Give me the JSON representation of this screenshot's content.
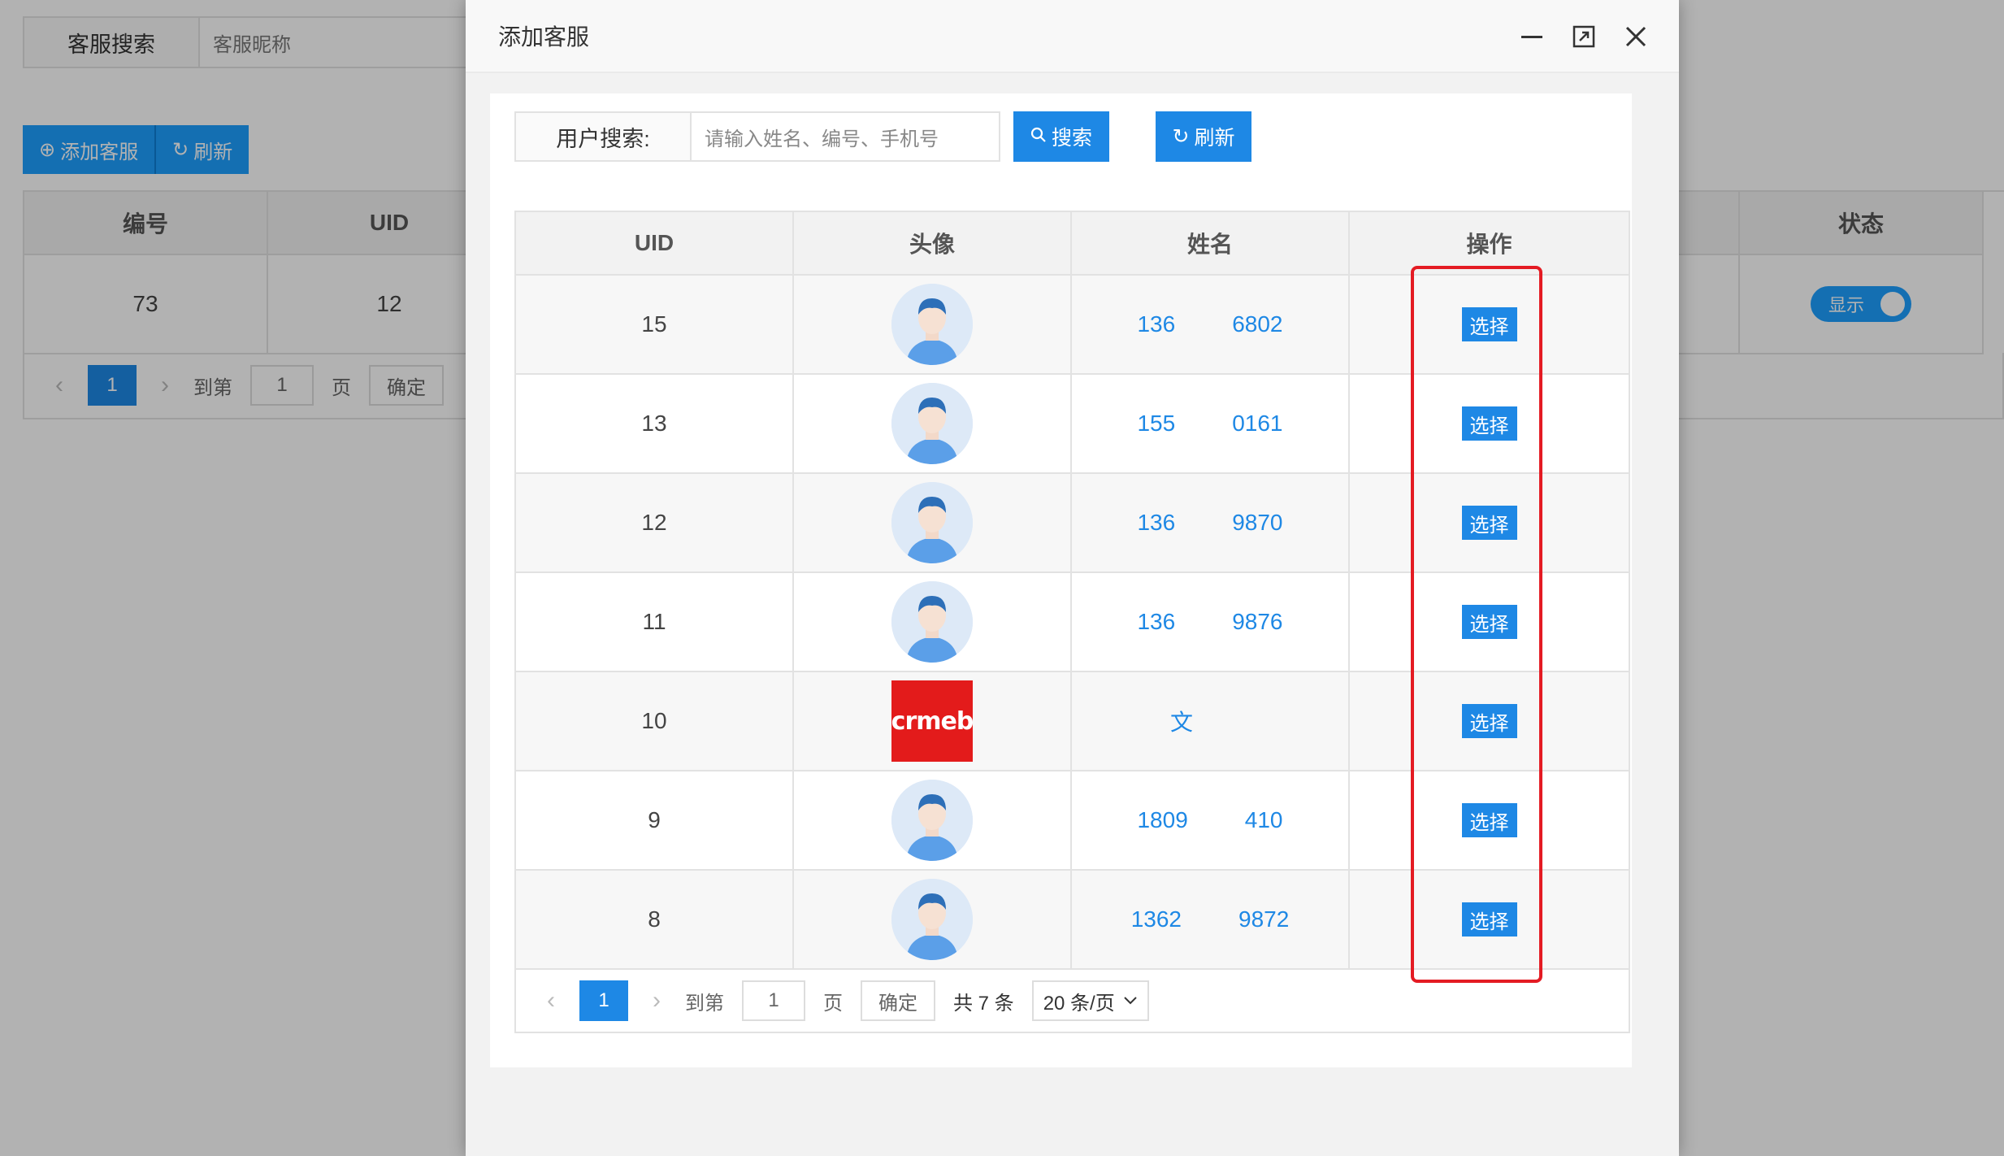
{
  "background": {
    "search": {
      "label": "客服搜索",
      "placeholder": "客服昵称"
    },
    "buttons": {
      "add": "添加客服",
      "refresh": "刷新"
    },
    "table": {
      "headers": [
        "编号",
        "UID",
        "",
        "",
        "",
        "",
        "状态"
      ],
      "row": {
        "id": "73",
        "uid": "12",
        "status": "显示"
      }
    },
    "pager": {
      "current": "1",
      "goto": "到第",
      "page_value": "1",
      "page_unit": "页",
      "confirm": "确定"
    }
  },
  "modal": {
    "title": "添加客服",
    "search": {
      "label": "用户搜索:",
      "placeholder": "请输入姓名、编号、手机号"
    },
    "buttons": {
      "search": "搜索",
      "refresh": "刷新"
    },
    "table": {
      "headers": {
        "uid": "UID",
        "avatar": "头像",
        "name": "姓名",
        "action": "操作"
      },
      "rows": [
        {
          "uid": "15",
          "name": "136",
          "name_tail": "6802",
          "avatar": "default-user",
          "action": "选择"
        },
        {
          "uid": "13",
          "name": "155",
          "name_tail": "0161",
          "avatar": "default-user",
          "action": "选择"
        },
        {
          "uid": "12",
          "name": "136",
          "name_tail": "9870",
          "avatar": "default-user",
          "action": "选择"
        },
        {
          "uid": "11",
          "name": "136",
          "name_tail": "9876",
          "avatar": "default-user",
          "action": "选择"
        },
        {
          "uid": "10",
          "name": "文",
          "name_tail": "",
          "avatar": "crmeb-logo",
          "action": "选择"
        },
        {
          "uid": "9",
          "name": "1809",
          "name_tail": "410",
          "avatar": "default-user",
          "action": "选择"
        },
        {
          "uid": "8",
          "name": "1362",
          "name_tail": "9872",
          "avatar": "default-user",
          "action": "选择"
        }
      ]
    },
    "pager": {
      "current": "1",
      "goto": "到第",
      "page_value": "1",
      "page_unit": "页",
      "confirm": "确定",
      "total": "共 7 条",
      "page_size": "20 条/页"
    },
    "crmeb_logo_text": "crmeb"
  },
  "colors": {
    "primary": "#1E88E5",
    "highlight": "#E41B23"
  }
}
